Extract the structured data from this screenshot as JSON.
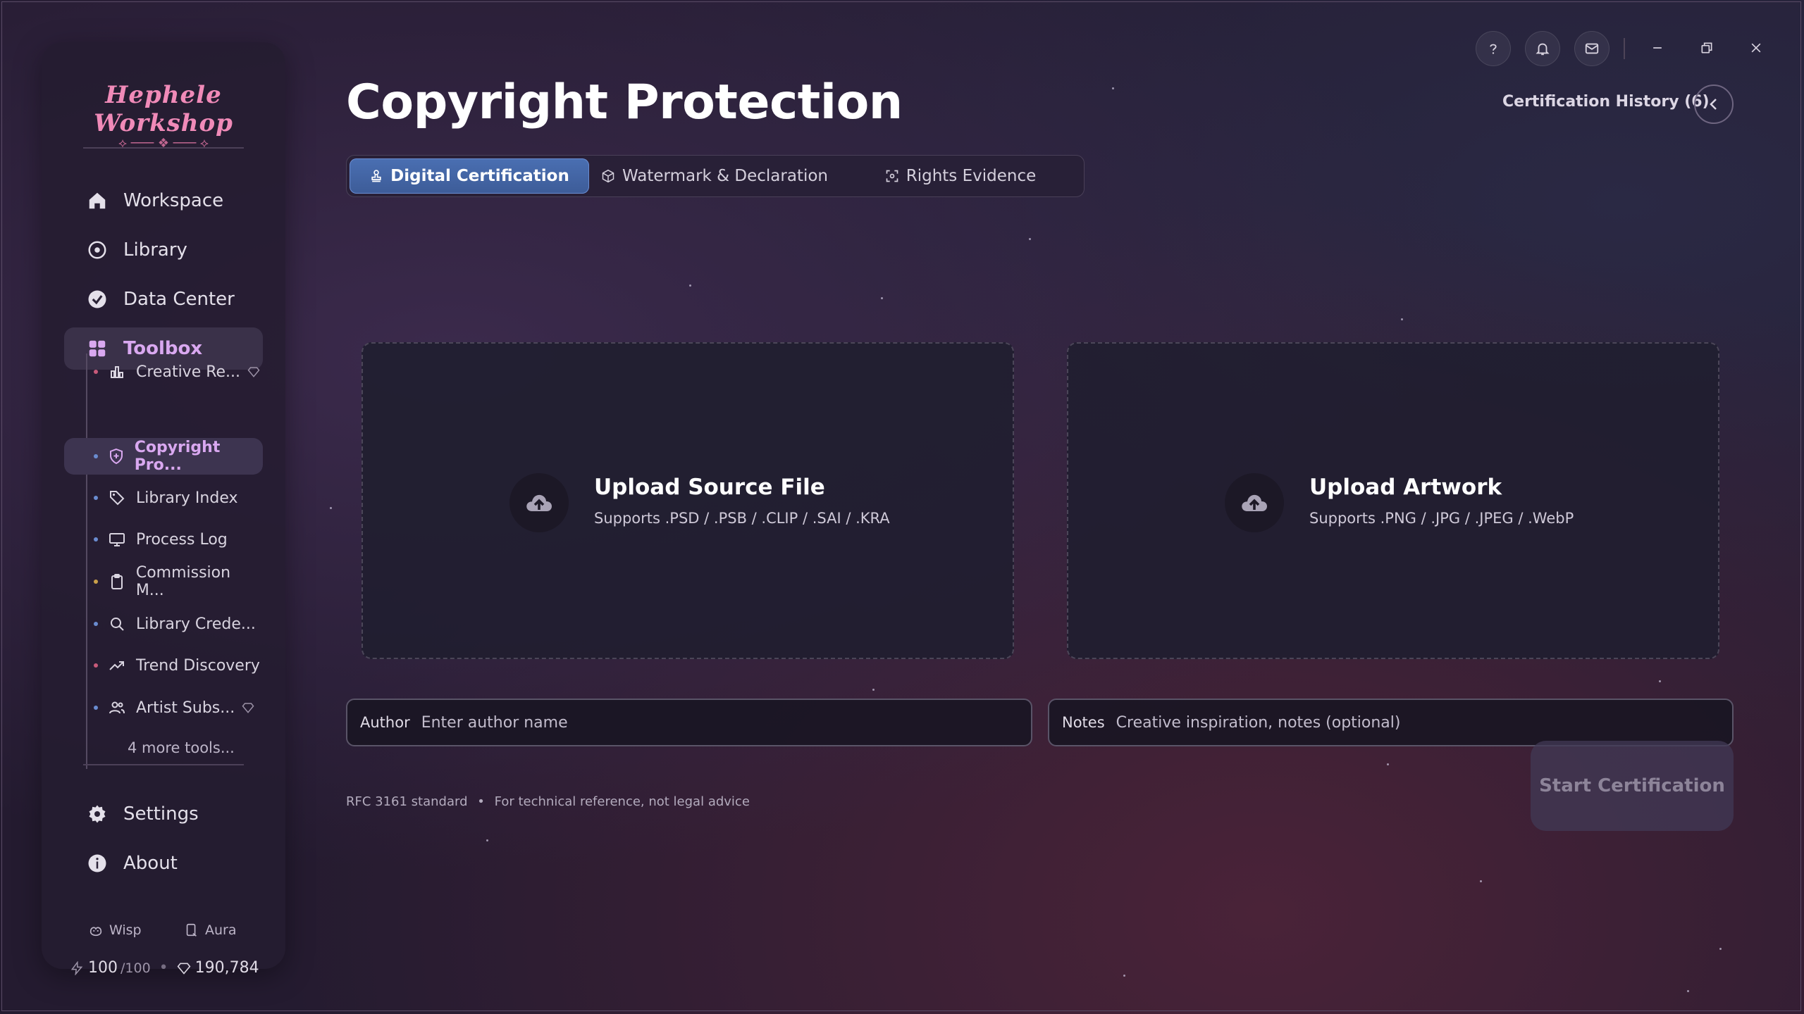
{
  "app": {
    "logo_text": "Hephele Workshop"
  },
  "sidebar": {
    "nav": [
      {
        "label": "Workspace",
        "icon": "home-icon"
      },
      {
        "label": "Library",
        "icon": "compass-icon"
      },
      {
        "label": "Data Center",
        "icon": "chart-check-icon"
      },
      {
        "label": "Toolbox",
        "icon": "grid-icon"
      }
    ],
    "tools": [
      {
        "label": "Creative Re...",
        "icon": "bar-chart-icon",
        "premium": true
      },
      {
        "label": "Copyright Pro...",
        "icon": "shield-icon",
        "active": true
      },
      {
        "label": "Library Index",
        "icon": "tag-icon"
      },
      {
        "label": "Process Log",
        "icon": "monitor-icon"
      },
      {
        "label": "Commission M...",
        "icon": "clipboard-icon"
      },
      {
        "label": "Library Crede...",
        "icon": "search-icon"
      },
      {
        "label": "Trend Discovery",
        "icon": "trending-icon"
      },
      {
        "label": "Artist Subs...",
        "icon": "users-icon",
        "premium": true
      }
    ],
    "more_tools": "4 more tools...",
    "bottom": [
      {
        "label": "Settings",
        "icon": "gear-icon"
      },
      {
        "label": "About",
        "icon": "info-icon"
      }
    ],
    "mini": [
      {
        "label": "Wisp",
        "icon": "wisp-icon"
      },
      {
        "label": "Aura",
        "icon": "aura-icon"
      }
    ],
    "energy": "100",
    "energy_max": "/100",
    "gems": "190,784"
  },
  "header": {
    "title": "Copyright Protection",
    "history": "Certification History (6)"
  },
  "tabs": [
    {
      "label": "Digital Certification",
      "icon": "stamp-icon",
      "active": true
    },
    {
      "label": "Watermark & Declaration",
      "icon": "cube-icon"
    },
    {
      "label": "Rights Evidence",
      "icon": "scan-icon"
    }
  ],
  "uploads": [
    {
      "title": "Upload Source File",
      "subtitle": "Supports .PSD / .PSB / .CLIP / .SAI / .KRA"
    },
    {
      "title": "Upload Artwork",
      "subtitle": "Supports .PNG / .JPG / .JPEG / .WebP"
    }
  ],
  "form": {
    "author_label": "Author",
    "author_placeholder": "Enter author name",
    "notes_label": "Notes",
    "notes_placeholder": "Creative inspiration, notes (optional)"
  },
  "footer": {
    "standard": "RFC 3161 standard",
    "separator": "•",
    "disclaimer": "For technical reference, not legal advice"
  },
  "actions": {
    "start_label": "Start Certification"
  },
  "colors": {
    "accent": "#4a6fb2",
    "logo": "#f08ab8",
    "active_text": "#d9a8f0"
  }
}
